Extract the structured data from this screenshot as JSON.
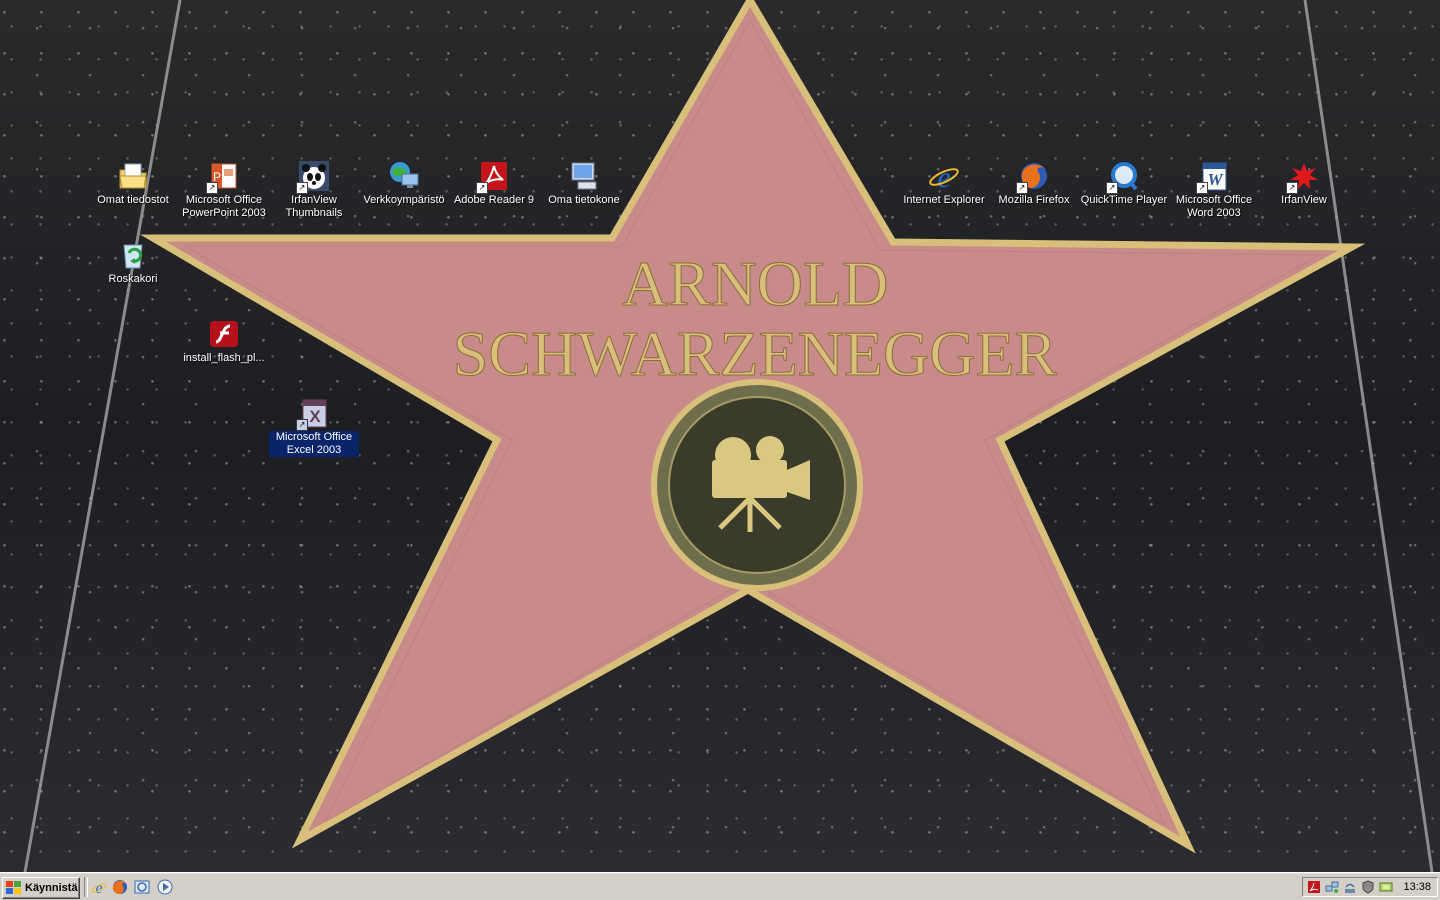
{
  "desktop": {
    "icons": [
      {
        "label": "Omat tiedostot",
        "icon": "my-documents-icon"
      },
      {
        "label": "Microsoft Office PowerPoint 2003",
        "icon": "powerpoint-icon"
      },
      {
        "label": "IrfanView Thumbnails",
        "icon": "panda-icon"
      },
      {
        "label": "Verkkoympäristö",
        "icon": "network-icon"
      },
      {
        "label": "Adobe Reader 9",
        "icon": "adobe-reader-icon"
      },
      {
        "label": "Oma tietokone",
        "icon": "my-computer-icon"
      },
      {
        "label": "Internet Explorer",
        "icon": "internet-explorer-icon"
      },
      {
        "label": "Mozilla Firefox",
        "icon": "firefox-icon"
      },
      {
        "label": "QuickTime Player",
        "icon": "quicktime-icon"
      },
      {
        "label": "Microsoft Office Word 2003",
        "icon": "word-icon"
      },
      {
        "label": "IrfanView",
        "icon": "irfanview-icon"
      },
      {
        "label": "Roskakori",
        "icon": "recycle-bin-icon"
      },
      {
        "label": "install_flash_pl...",
        "icon": "flash-installer-icon"
      },
      {
        "label": "Microsoft Office Excel 2003",
        "icon": "excel-icon"
      }
    ],
    "wallpaper": {
      "line1": "ARNOLD",
      "line2": "SCHWARZENEGGER"
    }
  },
  "taskbar": {
    "start_label": "Käynnistä",
    "quick_launch": [
      "internet-explorer-icon",
      "firefox-icon",
      "outlook-express-icon",
      "media-player-icon"
    ],
    "tray_icons": [
      "adobe-icon",
      "network-icon",
      "wifi-icon",
      "shield-icon",
      "security-icon"
    ],
    "clock": "13:38"
  },
  "colors": {
    "taskbar": "#d4d0c8",
    "selection": "#0a246a",
    "star_pink": "#c98a8a",
    "star_gold": "#d8bf7a"
  }
}
